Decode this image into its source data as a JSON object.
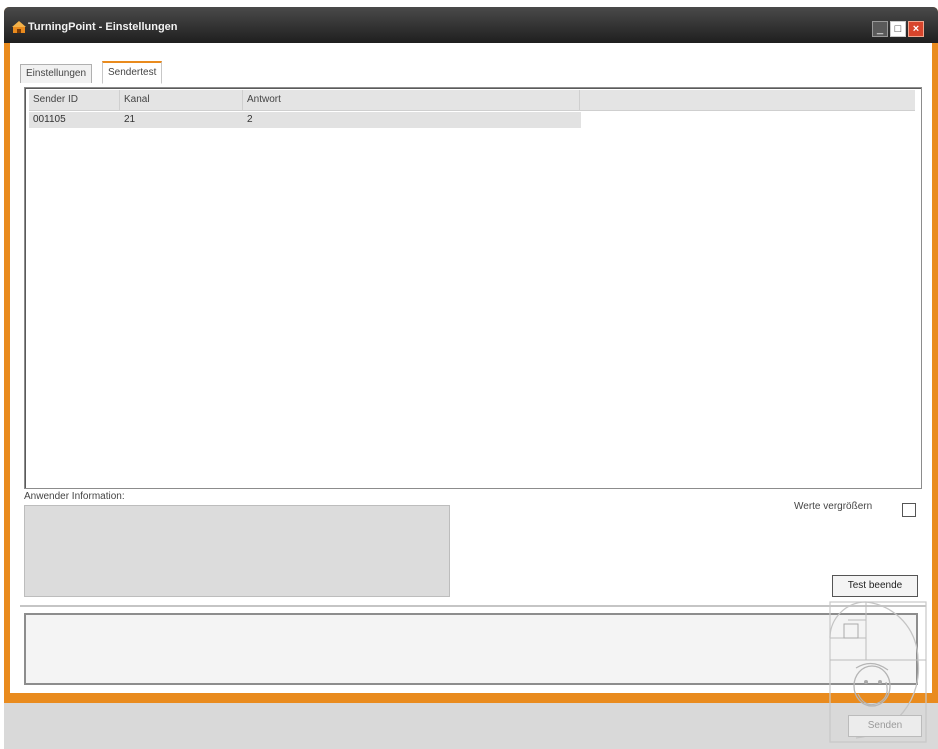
{
  "window": {
    "title": "TurningPoint - Einstellungen",
    "accent_color": "#e98b1e",
    "controls": {
      "minimize": "_",
      "maximize": "□",
      "close": "×"
    }
  },
  "tabs": [
    {
      "label": "Einstellungen",
      "active": false
    },
    {
      "label": "Sendertest",
      "active": true
    }
  ],
  "table": {
    "columns": [
      "Sender ID",
      "Kanal",
      "Antwort"
    ],
    "rows": [
      {
        "sender_id": "001105",
        "kanal": "21",
        "antwort": "2"
      }
    ]
  },
  "user_info": {
    "label": "Anwender Information:",
    "value": ""
  },
  "enlarge_values": {
    "label": "Werte vergrößern",
    "checked": false
  },
  "buttons": {
    "end_test": "Test beende",
    "send": "Senden"
  },
  "icons": [
    "app-icon",
    "minimize-icon",
    "maximize-icon",
    "close-icon",
    "watermark-logo"
  ]
}
